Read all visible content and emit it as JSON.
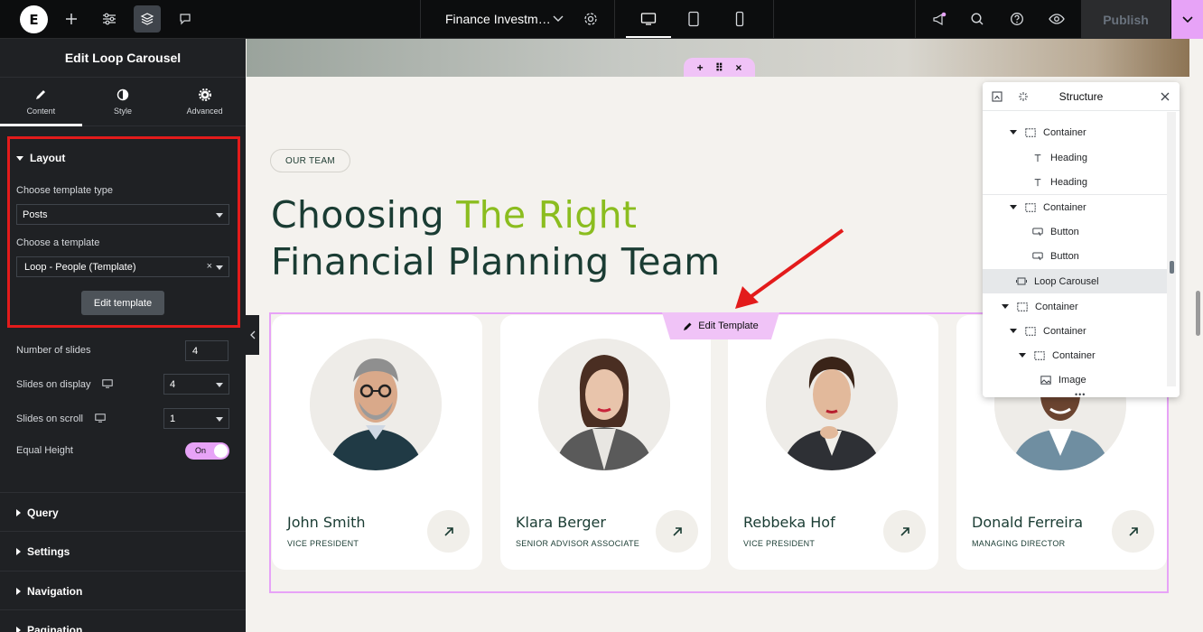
{
  "topbar": {
    "doc_title": "Finance Investm…",
    "publish_label": "Publish"
  },
  "panel": {
    "title": "Edit Loop Carousel",
    "tabs": [
      {
        "label": "Content"
      },
      {
        "label": "Style"
      },
      {
        "label": "Advanced"
      }
    ],
    "layout": {
      "title": "Layout",
      "template_type_label": "Choose template type",
      "template_type_value": "Posts",
      "template_label": "Choose a template",
      "template_value": "Loop - People (Template)",
      "clear_symbol": "×",
      "edit_button": "Edit template",
      "slides_label": "Number of slides",
      "slides_value": "4",
      "display_label": "Slides on display",
      "display_value": "4",
      "scroll_label": "Slides on scroll",
      "scroll_value": "1",
      "equal_height_label": "Equal Height",
      "equal_height_toggle": "On"
    },
    "sections": [
      "Query",
      "Settings",
      "Navigation",
      "Pagination"
    ]
  },
  "canvas": {
    "pill": "OUR TEAM",
    "headline_part1": "Choosing ",
    "headline_accent": "The Right",
    "headline_line2": "Financial Planning Team",
    "edit_template_label": "Edit Template",
    "accent_color": "#8bbd1f",
    "cards": [
      {
        "name": "John Smith",
        "role": "VICE PRESIDENT"
      },
      {
        "name": "Klara Berger",
        "role": "SENIOR ADVISOR ASSOCIATE"
      },
      {
        "name": "Rebbeka Hof",
        "role": "VICE PRESIDENT"
      },
      {
        "name": "Donald Ferreira",
        "role": "MANAGING DIRECTOR"
      }
    ]
  },
  "structure": {
    "title": "Structure",
    "rows": [
      {
        "label": "Container"
      },
      {
        "label": "Heading"
      },
      {
        "label": "Heading"
      },
      {
        "label": "Container"
      },
      {
        "label": "Button"
      },
      {
        "label": "Button"
      },
      {
        "label": "Loop Carousel"
      },
      {
        "label": "Container"
      },
      {
        "label": "Container"
      },
      {
        "label": "Container"
      },
      {
        "label": "Image"
      }
    ]
  }
}
